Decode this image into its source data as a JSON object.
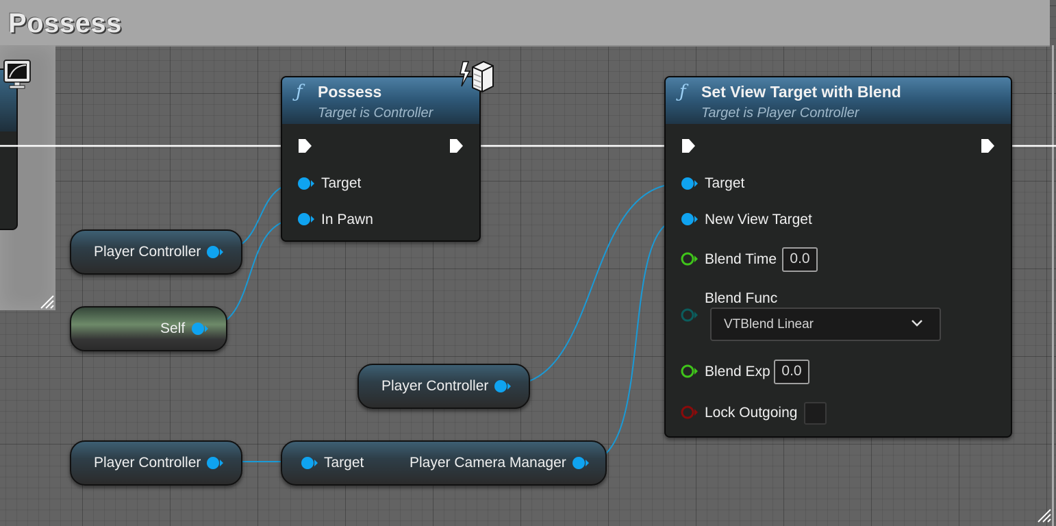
{
  "comment": {
    "title": "Possess"
  },
  "possess_node": {
    "title": "Possess",
    "subtitle": "Target is Controller",
    "pins": {
      "target": "Target",
      "in_pawn": "In Pawn"
    }
  },
  "set_view_node": {
    "title": "Set View Target with Blend",
    "subtitle": "Target is Player Controller",
    "pins": {
      "target": "Target",
      "new_view_target": "New View Target",
      "blend_time": "Blend Time",
      "blend_time_value": "0.0",
      "blend_func": "Blend Func",
      "blend_func_value": "VTBlend Linear",
      "blend_exp": "Blend Exp",
      "blend_exp_value": "0.0",
      "lock_outgoing": "Lock Outgoing"
    }
  },
  "variables": {
    "player_controller_1": "Player Controller",
    "self": "Self",
    "player_controller_2": "Player Controller",
    "player_controller_3": "Player Controller"
  },
  "camera_manager_node": {
    "target": "Target",
    "output": "Player Camera Manager"
  },
  "colors": {
    "object_pin": "#0fa3f0",
    "float_pin": "#3fc41a",
    "enum_pin": "#0b5d5d",
    "bool_pin": "#8a0b0b",
    "exec_wire": "#ffffff",
    "object_wire": "#1a9ad6"
  }
}
